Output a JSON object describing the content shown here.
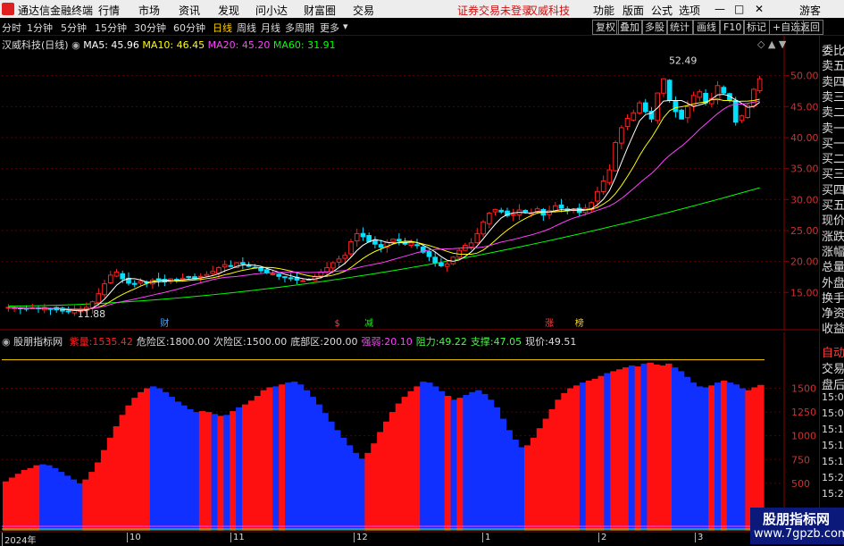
{
  "app": {
    "title": "通达信金融终端",
    "menu": [
      "行情",
      "市场",
      "资讯",
      "发现",
      "问小达",
      "财富圈",
      "交易"
    ],
    "status_login": "证券交易未登录",
    "status_stock": "汉威科技",
    "right_menu": [
      "功能",
      "版面",
      "公式",
      "选项"
    ],
    "guest": "游客"
  },
  "toolbar": {
    "periods": [
      "分时",
      "1分钟",
      "5分钟",
      "15分钟",
      "30分钟",
      "60分钟",
      "日线",
      "周线",
      "月线",
      "多周期",
      "更多"
    ],
    "selected": "日线",
    "buttons": [
      "复权",
      "叠加",
      "多股",
      "统计",
      "画线",
      "F10",
      "标记",
      "+自选",
      "返回"
    ]
  },
  "main_chart": {
    "stock_label": "汉威科技(日线)",
    "ma": [
      {
        "label": "MA5: 45.96",
        "color": "#ffffff"
      },
      {
        "label": "MA10: 46.45",
        "color": "#ffff00"
      },
      {
        "label": "MA20: 45.20",
        "color": "#ff40ff"
      },
      {
        "label": "MA60: 31.91",
        "color": "#00ff00"
      }
    ],
    "high_label": "52.49",
    "low_label": "11.88",
    "axis_labels": [
      "50.00",
      "45.00",
      "40.00",
      "35.00",
      "30.00",
      "25.00",
      "20.00",
      "15.00"
    ],
    "markers": [
      {
        "text": "财",
        "color": "#4da6ff"
      },
      {
        "text": "$",
        "color": "#ff4040"
      },
      {
        "text": "减",
        "color": "#00ff00"
      },
      {
        "text": "涨",
        "color": "#ff4040"
      },
      {
        "text": "榜",
        "color": "#ffd000"
      }
    ]
  },
  "indicator": {
    "name": "股朋指标网",
    "values": [
      {
        "label": "紫量:",
        "value": "1535.42",
        "color": "#ff2020"
      },
      {
        "label": "危险区:",
        "value": "1800.00",
        "color": "#dddddd"
      },
      {
        "label": "次险区:",
        "value": "1500.00",
        "color": "#dddddd"
      },
      {
        "label": "底部区:",
        "value": "200.00",
        "color": "#dddddd"
      },
      {
        "label": "强弱:",
        "value": "20.10",
        "color": "#ff40ff"
      },
      {
        "label": "阻力:",
        "value": "49.22",
        "color": "#40ff40"
      },
      {
        "label": "支撑:",
        "value": "47.05",
        "color": "#40ff40"
      },
      {
        "label": "现价:",
        "value": "49.51",
        "color": "#dddddd"
      }
    ],
    "axis_labels": [
      "1500",
      "1250",
      "1000",
      "750",
      "500"
    ],
    "bars": [
      {
        "v": 520,
        "c": "r"
      },
      {
        "v": 560,
        "c": "r"
      },
      {
        "v": 600,
        "c": "r"
      },
      {
        "v": 640,
        "c": "r"
      },
      {
        "v": 660,
        "c": "r"
      },
      {
        "v": 690,
        "c": "r"
      },
      {
        "v": 700,
        "c": "b"
      },
      {
        "v": 690,
        "c": "b"
      },
      {
        "v": 660,
        "c": "b"
      },
      {
        "v": 620,
        "c": "b"
      },
      {
        "v": 580,
        "c": "b"
      },
      {
        "v": 540,
        "c": "b"
      },
      {
        "v": 500,
        "c": "b"
      },
      {
        "v": 540,
        "c": "r"
      },
      {
        "v": 620,
        "c": "r"
      },
      {
        "v": 720,
        "c": "r"
      },
      {
        "v": 850,
        "c": "r"
      },
      {
        "v": 980,
        "c": "r"
      },
      {
        "v": 1100,
        "c": "r"
      },
      {
        "v": 1220,
        "c": "r"
      },
      {
        "v": 1320,
        "c": "r"
      },
      {
        "v": 1400,
        "c": "r"
      },
      {
        "v": 1460,
        "c": "r"
      },
      {
        "v": 1500,
        "c": "r"
      },
      {
        "v": 1520,
        "c": "b"
      },
      {
        "v": 1500,
        "c": "b"
      },
      {
        "v": 1460,
        "c": "b"
      },
      {
        "v": 1410,
        "c": "b"
      },
      {
        "v": 1360,
        "c": "b"
      },
      {
        "v": 1320,
        "c": "b"
      },
      {
        "v": 1280,
        "c": "b"
      },
      {
        "v": 1250,
        "c": "b"
      },
      {
        "v": 1260,
        "c": "r"
      },
      {
        "v": 1250,
        "c": "r"
      },
      {
        "v": 1230,
        "c": "b"
      },
      {
        "v": 1210,
        "c": "r"
      },
      {
        "v": 1220,
        "c": "b"
      },
      {
        "v": 1260,
        "c": "r"
      },
      {
        "v": 1300,
        "c": "b"
      },
      {
        "v": 1330,
        "c": "r"
      },
      {
        "v": 1370,
        "c": "r"
      },
      {
        "v": 1420,
        "c": "r"
      },
      {
        "v": 1480,
        "c": "r"
      },
      {
        "v": 1510,
        "c": "r"
      },
      {
        "v": 1520,
        "c": "b"
      },
      {
        "v": 1540,
        "c": "r"
      },
      {
        "v": 1560,
        "c": "b"
      },
      {
        "v": 1570,
        "c": "b"
      },
      {
        "v": 1540,
        "c": "b"
      },
      {
        "v": 1480,
        "c": "b"
      },
      {
        "v": 1410,
        "c": "b"
      },
      {
        "v": 1330,
        "c": "b"
      },
      {
        "v": 1240,
        "c": "b"
      },
      {
        "v": 1150,
        "c": "b"
      },
      {
        "v": 1060,
        "c": "b"
      },
      {
        "v": 980,
        "c": "b"
      },
      {
        "v": 900,
        "c": "b"
      },
      {
        "v": 820,
        "c": "b"
      },
      {
        "v": 760,
        "c": "b"
      },
      {
        "v": 820,
        "c": "r"
      },
      {
        "v": 920,
        "c": "r"
      },
      {
        "v": 1040,
        "c": "r"
      },
      {
        "v": 1150,
        "c": "r"
      },
      {
        "v": 1250,
        "c": "r"
      },
      {
        "v": 1340,
        "c": "r"
      },
      {
        "v": 1410,
        "c": "r"
      },
      {
        "v": 1470,
        "c": "r"
      },
      {
        "v": 1520,
        "c": "r"
      },
      {
        "v": 1570,
        "c": "b"
      },
      {
        "v": 1560,
        "c": "b"
      },
      {
        "v": 1520,
        "c": "b"
      },
      {
        "v": 1470,
        "c": "b"
      },
      {
        "v": 1420,
        "c": "r"
      },
      {
        "v": 1380,
        "c": "b"
      },
      {
        "v": 1400,
        "c": "r"
      },
      {
        "v": 1430,
        "c": "b"
      },
      {
        "v": 1460,
        "c": "b"
      },
      {
        "v": 1480,
        "c": "b"
      },
      {
        "v": 1440,
        "c": "b"
      },
      {
        "v": 1380,
        "c": "b"
      },
      {
        "v": 1300,
        "c": "b"
      },
      {
        "v": 1180,
        "c": "b"
      },
      {
        "v": 1060,
        "c": "b"
      },
      {
        "v": 960,
        "c": "b"
      },
      {
        "v": 880,
        "c": "b"
      },
      {
        "v": 900,
        "c": "r"
      },
      {
        "v": 980,
        "c": "r"
      },
      {
        "v": 1080,
        "c": "r"
      },
      {
        "v": 1180,
        "c": "r"
      },
      {
        "v": 1280,
        "c": "r"
      },
      {
        "v": 1380,
        "c": "r"
      },
      {
        "v": 1450,
        "c": "r"
      },
      {
        "v": 1500,
        "c": "r"
      },
      {
        "v": 1530,
        "c": "r"
      },
      {
        "v": 1560,
        "c": "b"
      },
      {
        "v": 1580,
        "c": "r"
      },
      {
        "v": 1600,
        "c": "r"
      },
      {
        "v": 1630,
        "c": "r"
      },
      {
        "v": 1660,
        "c": "b"
      },
      {
        "v": 1680,
        "c": "r"
      },
      {
        "v": 1700,
        "c": "r"
      },
      {
        "v": 1720,
        "c": "r"
      },
      {
        "v": 1740,
        "c": "b"
      },
      {
        "v": 1730,
        "c": "r"
      },
      {
        "v": 1760,
        "c": "b"
      },
      {
        "v": 1770,
        "c": "r"
      },
      {
        "v": 1750,
        "c": "r"
      },
      {
        "v": 1740,
        "c": "r"
      },
      {
        "v": 1760,
        "c": "r"
      },
      {
        "v": 1720,
        "c": "b"
      },
      {
        "v": 1680,
        "c": "b"
      },
      {
        "v": 1620,
        "c": "b"
      },
      {
        "v": 1560,
        "c": "b"
      },
      {
        "v": 1520,
        "c": "b"
      },
      {
        "v": 1510,
        "c": "b"
      },
      {
        "v": 1530,
        "c": "r"
      },
      {
        "v": 1560,
        "c": "b"
      },
      {
        "v": 1580,
        "c": "r"
      },
      {
        "v": 1560,
        "c": "b"
      },
      {
        "v": 1540,
        "c": "b"
      },
      {
        "v": 1500,
        "c": "b"
      },
      {
        "v": 1480,
        "c": "r"
      },
      {
        "v": 1510,
        "c": "r"
      },
      {
        "v": 1535,
        "c": "r"
      }
    ]
  },
  "price_chart": {
    "closes": [
      12.6,
      12.5,
      12.4,
      12.3,
      12.5,
      12.4,
      12.6,
      12.3,
      12.2,
      12.0,
      11.9,
      12.1,
      12.3,
      12.6,
      13.5,
      14.8,
      16.4,
      17.8,
      18.3,
      17.2,
      16.5,
      16.3,
      16.8,
      16.6,
      17.0,
      16.9,
      16.7,
      17.2,
      17.0,
      17.3,
      17.5,
      17.2,
      17.6,
      17.9,
      18.4,
      19.0,
      19.5,
      19.3,
      19.8,
      19.6,
      19.2,
      19.0,
      18.5,
      18.2,
      18.0,
      17.6,
      17.4,
      17.2,
      17.0,
      16.9,
      17.1,
      17.6,
      18.3,
      19.0,
      19.8,
      20.4,
      21.0,
      23.2,
      24.5,
      24.0,
      23.2,
      22.8,
      22.3,
      23.1,
      23.6,
      23.3,
      22.8,
      23.0,
      22.6,
      21.5,
      20.8,
      19.8,
      19.3,
      19.6,
      20.7,
      21.8,
      22.6,
      23.0,
      24.5,
      26.4,
      27.8,
      28.4,
      28.0,
      27.4,
      27.6,
      28.3,
      28.0,
      27.8,
      28.5,
      27.5,
      28.2,
      29.0,
      28.6,
      28.2,
      28.4,
      27.9,
      28.6,
      29.5,
      31.3,
      33.0,
      34.8,
      39.2,
      41.6,
      43.1,
      44.0,
      45.6,
      44.2,
      43.0,
      47.2,
      49.5,
      46.0,
      44.2,
      43.0,
      45.0,
      46.8,
      47.4,
      45.6,
      46.3,
      48.4,
      47.2,
      46.0,
      42.5,
      43.5,
      45.2,
      47.8,
      49.5
    ],
    "ma60_start": 12.8,
    "ma60_end": 31.9
  },
  "x_axis": {
    "labels": [
      "2024年",
      "10",
      "11",
      "12",
      "1",
      "2",
      "3"
    ]
  },
  "right_panel": {
    "main_items": [
      "委比",
      "卖五",
      "卖四",
      "卖三",
      "卖二",
      "卖一",
      "买一",
      "买二",
      "买三",
      "买四",
      "买五",
      "现价",
      "涨跌",
      "涨幅",
      "总量",
      "外盘",
      "换手",
      "净资",
      "收益"
    ],
    "ind_items": [
      "自动",
      "交易",
      "盘后",
      "15:00",
      "15:0",
      "15:1",
      "15:1",
      "15:1",
      "15:2",
      "15:2"
    ]
  },
  "watermark": {
    "line1": "股朋指标网",
    "line2": "www.7gpzb.com"
  },
  "colors": {
    "up": "#ff2020",
    "down": "#00e0ff",
    "bar_red": "#ff1010",
    "bar_blue": "#1030ff"
  }
}
